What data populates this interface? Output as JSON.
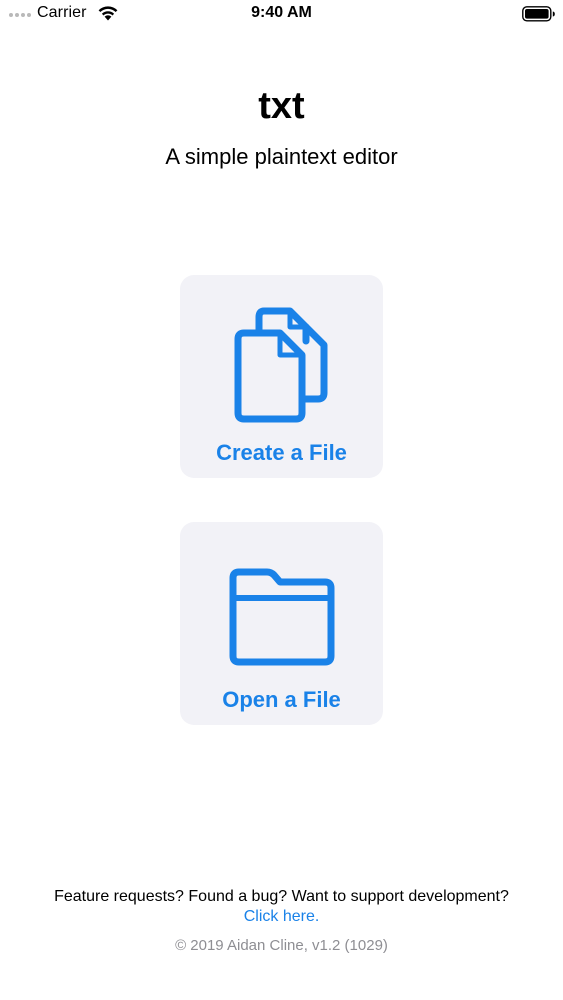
{
  "status_bar": {
    "carrier": "Carrier",
    "time": "9:40 AM",
    "icons": [
      "signal-dots-icon",
      "wifi-icon",
      "battery-icon"
    ]
  },
  "header": {
    "title": "txt",
    "subtitle": "A simple plaintext editor"
  },
  "actions": {
    "create": {
      "label": "Create a File",
      "icon": "documents-icon"
    },
    "open": {
      "label": "Open a File",
      "icon": "folder-icon"
    }
  },
  "footer": {
    "question": "Feature requests? Found a bug? Want to support development?",
    "link": "Click here.",
    "copyright": "© 2019 Aidan Cline, v1.2 (1029)"
  },
  "colors": {
    "accent": "#1a82e8",
    "card_background": "#f2f2f7",
    "secondary_text": "#8e8e93"
  }
}
